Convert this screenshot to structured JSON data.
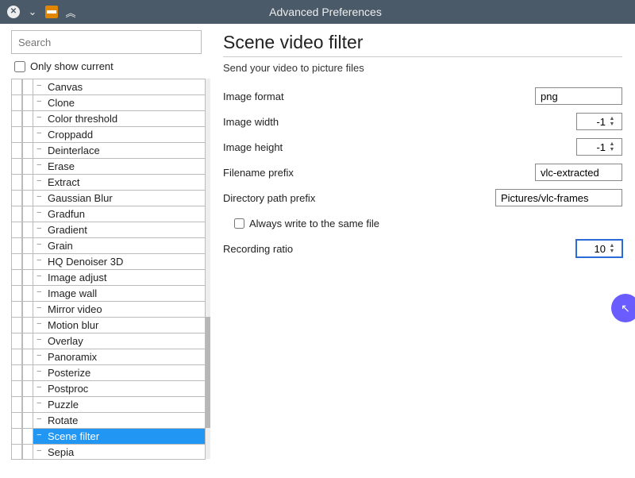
{
  "window": {
    "title": "Advanced Preferences"
  },
  "sidebar": {
    "search_placeholder": "Search",
    "only_show_current_label": "Only show current",
    "items": [
      "Canvas",
      "Clone",
      "Color threshold",
      "Croppadd",
      "Deinterlace",
      "Erase",
      "Extract",
      "Gaussian Blur",
      "Gradfun",
      "Gradient",
      "Grain",
      "HQ Denoiser 3D",
      "Image adjust",
      "Image wall",
      "Mirror video",
      "Motion blur",
      "Overlay",
      "Panoramix",
      "Posterize",
      "Postproc",
      "Puzzle",
      "Rotate",
      "Scene filter",
      "Sepia"
    ],
    "selected_index": 22
  },
  "panel": {
    "heading": "Scene video filter",
    "description": "Send your video to picture files",
    "fields": {
      "image_format": {
        "label": "Image format",
        "value": "png"
      },
      "image_width": {
        "label": "Image width",
        "value": "-1"
      },
      "image_height": {
        "label": "Image height",
        "value": "-1"
      },
      "filename_prefix": {
        "label": "Filename prefix",
        "value": "vlc-extracted"
      },
      "directory_path_prefix": {
        "label": "Directory path prefix",
        "value": "Pictures/vlc-frames"
      },
      "always_write_same_file": {
        "label": "Always write to the same file",
        "checked": false
      },
      "recording_ratio": {
        "label": "Recording ratio",
        "value": "10"
      }
    }
  }
}
